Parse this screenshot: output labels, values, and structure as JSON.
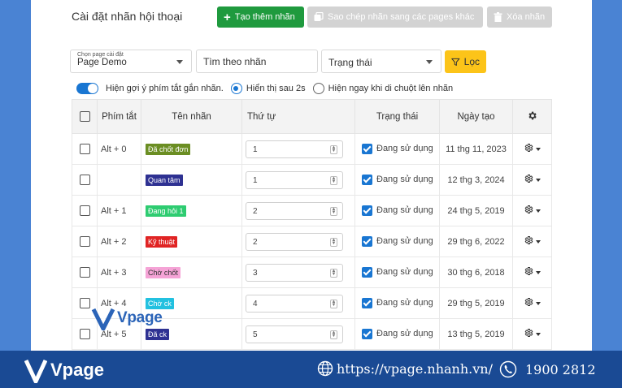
{
  "header": {
    "title": "Cài đặt nhãn hội thoại",
    "create_label": "Tạo thêm nhãn",
    "copy_label": "Sao chép nhãn sang các pages khác",
    "delete_label": "Xóa nhãn"
  },
  "filters": {
    "page_caption": "Chọn page cài đặt",
    "page_value": "Page Demo",
    "search_placeholder": "Tìm theo nhãn",
    "status_value": "Trạng thái",
    "filter_label": "Lọc"
  },
  "options": {
    "toggle_label": "Hiện gợi ý phím tắt gắn nhãn.",
    "radio1_label": "Hiển thị sau 2s",
    "radio2_label": "Hiện ngay khi di chuột lên nhãn"
  },
  "table": {
    "headers": {
      "shortcut": "Phím tắt",
      "name": "Tên nhãn",
      "order": "Thứ tự",
      "status": "Trạng thái",
      "created": "Ngày tạo"
    },
    "rows": [
      {
        "shortcut": "Alt + 0",
        "name": "Đã chốt đơn",
        "color": "#6b8e23",
        "order": "1",
        "status": "Đang sử dụng",
        "created": "11 thg 11, 2023"
      },
      {
        "shortcut": "",
        "name": "Quan tâm",
        "color": "#2e3192",
        "order": "1",
        "status": "Đang sử dụng",
        "created": "12 thg 3, 2024"
      },
      {
        "shortcut": "Alt + 1",
        "name": "Đang hỏi 1",
        "color": "#2ecc71",
        "order": "2",
        "status": "Đang sử dụng",
        "created": "24 thg 5, 2019"
      },
      {
        "shortcut": "Alt + 2",
        "name": "Kỹ thuật",
        "color": "#e02424",
        "order": "2",
        "status": "Đang sử dụng",
        "created": "29 thg 6, 2022"
      },
      {
        "shortcut": "Alt + 3",
        "name": "Chờ chốt",
        "color": "#f5a3d6",
        "text_color": "#333333",
        "order": "3",
        "status": "Đang sử dụng",
        "created": "30 thg 6, 2018"
      },
      {
        "shortcut": "Alt + 4",
        "name": "Chờ ck",
        "color": "#22c1e0",
        "order": "4",
        "status": "Đang sử dụng",
        "created": "29 thg 5, 2019"
      },
      {
        "shortcut": "Alt + 5",
        "name": "Đã ck",
        "color": "#2e3192",
        "order": "5",
        "status": "Đang sử dụng",
        "created": "13 thg 5, 2019"
      }
    ]
  },
  "watermark": {
    "brand": "Vpage"
  },
  "footer": {
    "brand": "Vpage",
    "website": "https://vpage.nhanh.vn/",
    "phone": "1900 2812"
  },
  "colors": {
    "primary": "#1976d2",
    "create": "#1f9a3e",
    "filter": "#fcc419",
    "footer": "#1a4a94",
    "outer": "#4a83d3"
  }
}
